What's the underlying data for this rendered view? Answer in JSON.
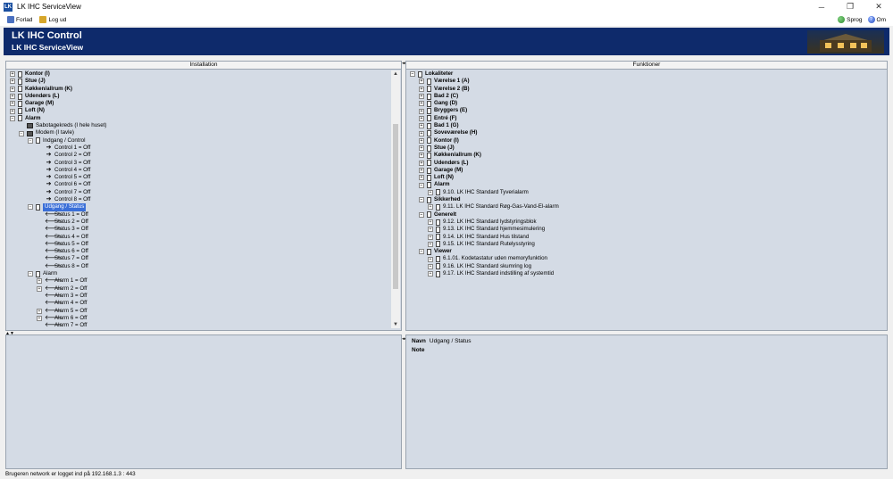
{
  "window": {
    "title": "LK IHC ServiceView",
    "logo": "LK"
  },
  "menu": {
    "left": [
      {
        "label": "Forlad",
        "icon": "exit-icon"
      },
      {
        "label": "Log ud",
        "icon": "key-icon"
      }
    ],
    "right": [
      {
        "label": "Sprog",
        "icon": "globe-icon"
      },
      {
        "label": "Om",
        "icon": "help-icon"
      }
    ]
  },
  "banner": {
    "title": "LK IHC Control",
    "subtitle": "LK IHC ServiceView"
  },
  "installation": {
    "header": "Installation",
    "items": [
      {
        "label": "Kontor (I)",
        "depth": 0,
        "exp": "+",
        "icon": "doc",
        "bold": true
      },
      {
        "label": "Stue (J)",
        "depth": 0,
        "exp": "+",
        "icon": "doc",
        "bold": true
      },
      {
        "label": "Køkken/allrum (K)",
        "depth": 0,
        "exp": "+",
        "icon": "doc",
        "bold": true
      },
      {
        "label": "Udendørs (L)",
        "depth": 0,
        "exp": "+",
        "icon": "doc",
        "bold": true
      },
      {
        "label": "Garage (M)",
        "depth": 0,
        "exp": "+",
        "icon": "doc",
        "bold": true
      },
      {
        "label": "Loft (N)",
        "depth": 0,
        "exp": "+",
        "icon": "doc",
        "bold": true
      },
      {
        "label": "Alarm",
        "depth": 0,
        "exp": "−",
        "icon": "doc",
        "bold": true
      },
      {
        "label": "Sabotagekreds (I hele huset)",
        "depth": 1,
        "exp": "",
        "icon": "dev"
      },
      {
        "label": "Modem (I tavle)",
        "depth": 1,
        "exp": "−",
        "icon": "dev"
      },
      {
        "label": "Indgang / Control",
        "depth": 2,
        "exp": "−",
        "icon": "doc"
      },
      {
        "label": "Control 1 = Off",
        "depth": 3,
        "exp": "",
        "icon": "arrow-right"
      },
      {
        "label": "Control 2 = Off",
        "depth": 3,
        "exp": "",
        "icon": "arrow-right"
      },
      {
        "label": "Control 3 = Off",
        "depth": 3,
        "exp": "",
        "icon": "arrow-right"
      },
      {
        "label": "Control 4 = Off",
        "depth": 3,
        "exp": "",
        "icon": "arrow-right"
      },
      {
        "label": "Control 5 = Off",
        "depth": 3,
        "exp": "",
        "icon": "arrow-right"
      },
      {
        "label": "Control 6 = Off",
        "depth": 3,
        "exp": "",
        "icon": "arrow-right"
      },
      {
        "label": "Control 7 = Off",
        "depth": 3,
        "exp": "",
        "icon": "arrow-right"
      },
      {
        "label": "Control 8 = Off",
        "depth": 3,
        "exp": "",
        "icon": "arrow-right"
      },
      {
        "label": "Udgang / Status",
        "depth": 2,
        "exp": "−",
        "icon": "doc",
        "selected": true
      },
      {
        "label": "Status 1 = Off",
        "depth": 3,
        "exp": "",
        "icon": "arrow-left"
      },
      {
        "label": "Status 2 = Off",
        "depth": 3,
        "exp": "",
        "icon": "arrow-left"
      },
      {
        "label": "Status 3 = Off",
        "depth": 3,
        "exp": "",
        "icon": "arrow-left"
      },
      {
        "label": "Status 4 = Off",
        "depth": 3,
        "exp": "",
        "icon": "arrow-left"
      },
      {
        "label": "Status 5 = Off",
        "depth": 3,
        "exp": "",
        "icon": "arrow-left"
      },
      {
        "label": "Status 6 = Off",
        "depth": 3,
        "exp": "",
        "icon": "arrow-left"
      },
      {
        "label": "Status 7 = Off",
        "depth": 3,
        "exp": "",
        "icon": "arrow-left"
      },
      {
        "label": "Status 8 = Off",
        "depth": 3,
        "exp": "",
        "icon": "arrow-left"
      },
      {
        "label": "Alarm",
        "depth": 2,
        "exp": "−",
        "icon": "doc"
      },
      {
        "label": "Alarm 1 = Off",
        "depth": 3,
        "exp": "+",
        "icon": "arrow-left"
      },
      {
        "label": "Alarm 2 = Off",
        "depth": 3,
        "exp": "+",
        "icon": "arrow-left"
      },
      {
        "label": "Alarm 3 = Off",
        "depth": 3,
        "exp": "",
        "icon": "arrow-left"
      },
      {
        "label": "Alarm 4 = Off",
        "depth": 3,
        "exp": "",
        "icon": "arrow-left"
      },
      {
        "label": "Alarm 5 = Off",
        "depth": 3,
        "exp": "+",
        "icon": "arrow-left"
      },
      {
        "label": "Alarm 6 = Off",
        "depth": 3,
        "exp": "+",
        "icon": "arrow-left"
      },
      {
        "label": "Alarm 7 = Off",
        "depth": 3,
        "exp": "",
        "icon": "arrow-left"
      },
      {
        "label": "Alarm 8 = Off",
        "depth": 3,
        "exp": "",
        "icon": "arrow-left"
      }
    ]
  },
  "funktioner": {
    "header": "Funktioner",
    "items": [
      {
        "label": "Lokaliteter",
        "depth": 0,
        "exp": "−",
        "icon": "doc",
        "bold": true
      },
      {
        "label": "Værelse 1 (A)",
        "depth": 1,
        "exp": "+",
        "icon": "doc",
        "bold": true
      },
      {
        "label": "Værelse 2 (B)",
        "depth": 1,
        "exp": "+",
        "icon": "doc",
        "bold": true
      },
      {
        "label": "Bad 2 (C)",
        "depth": 1,
        "exp": "+",
        "icon": "doc",
        "bold": true
      },
      {
        "label": "Gang (D)",
        "depth": 1,
        "exp": "+",
        "icon": "doc",
        "bold": true
      },
      {
        "label": "Bryggers (E)",
        "depth": 1,
        "exp": "+",
        "icon": "doc",
        "bold": true
      },
      {
        "label": "Entré (F)",
        "depth": 1,
        "exp": "+",
        "icon": "doc",
        "bold": true
      },
      {
        "label": "Bad 1 (G)",
        "depth": 1,
        "exp": "+",
        "icon": "doc",
        "bold": true
      },
      {
        "label": "Soveværelse (H)",
        "depth": 1,
        "exp": "+",
        "icon": "doc",
        "bold": true
      },
      {
        "label": "Kontor (I)",
        "depth": 1,
        "exp": "+",
        "icon": "doc",
        "bold": true
      },
      {
        "label": "Stue (J)",
        "depth": 1,
        "exp": "+",
        "icon": "doc",
        "bold": true
      },
      {
        "label": "Køkken/allrum (K)",
        "depth": 1,
        "exp": "+",
        "icon": "doc",
        "bold": true
      },
      {
        "label": "Udendørs (L)",
        "depth": 1,
        "exp": "+",
        "icon": "doc",
        "bold": true
      },
      {
        "label": "Garage (M)",
        "depth": 1,
        "exp": "+",
        "icon": "doc",
        "bold": true
      },
      {
        "label": "Loft (N)",
        "depth": 1,
        "exp": "+",
        "icon": "doc",
        "bold": true
      },
      {
        "label": "Alarm",
        "depth": 1,
        "exp": "−",
        "icon": "doc",
        "bold": true
      },
      {
        "label": "9.10. LK IHC Standard Tyverialarm",
        "depth": 2,
        "exp": "+",
        "icon": "doc"
      },
      {
        "label": "Sikkerhed",
        "depth": 1,
        "exp": "−",
        "icon": "doc",
        "bold": true
      },
      {
        "label": "9.11. LK IHC Standard  Røg-Gas-Vand-El-alarm",
        "depth": 2,
        "exp": "+",
        "icon": "doc"
      },
      {
        "label": "Generelt",
        "depth": 1,
        "exp": "−",
        "icon": "doc",
        "bold": true
      },
      {
        "label": "9.12. LK IHC Standard lydstyringsblok",
        "depth": 2,
        "exp": "+",
        "icon": "doc"
      },
      {
        "label": "9.13. LK IHC Standard hjemmesimulering",
        "depth": 2,
        "exp": "+",
        "icon": "doc"
      },
      {
        "label": "9.14. LK IHC Standard Hus tilstand",
        "depth": 2,
        "exp": "+",
        "icon": "doc"
      },
      {
        "label": "9.15. LK IHC Standard Rutelysstyring",
        "depth": 2,
        "exp": "+",
        "icon": "doc"
      },
      {
        "label": "Viewer",
        "depth": 1,
        "exp": "−",
        "icon": "doc",
        "bold": true
      },
      {
        "label": "6.1.01. Kodetastatur uden memoryfunktion",
        "depth": 2,
        "exp": "+",
        "icon": "doc"
      },
      {
        "label": "9.16. LK IHC Standard skumring log",
        "depth": 2,
        "exp": "+",
        "icon": "doc"
      },
      {
        "label": "9.17. LK IHC Standard indstilling af systemtid",
        "depth": 2,
        "exp": "+",
        "icon": "doc"
      }
    ]
  },
  "details": {
    "navn_label": "Navn",
    "navn_value": "Udgang / Status",
    "note_label": "Note"
  },
  "status": {
    "text": "Brugeren network er logget ind på 192.168.1.3 : 443"
  },
  "colors": {
    "banner": "#0e2a6b",
    "panel": "#d4dbe5",
    "selection": "#3a6fd8"
  }
}
